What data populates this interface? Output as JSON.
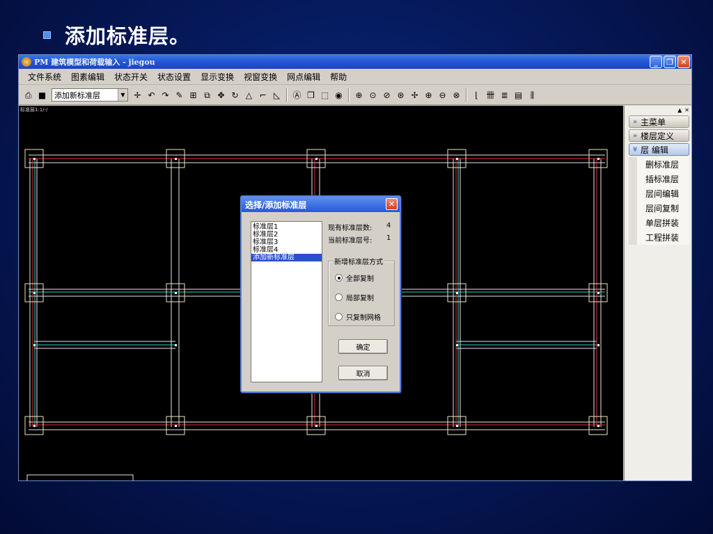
{
  "slide": {
    "title": "添加标准层。",
    "bullet_color": "#4f8de8"
  },
  "window": {
    "title": "PM 建筑模型和荷载输入 - jiegou",
    "buttons": {
      "minimize": "_",
      "maximize": "❐",
      "close": "✕"
    }
  },
  "menu": [
    "文件系统",
    "图素编辑",
    "状态开关",
    "状态设置",
    "显示变换",
    "视窗变换",
    "网点编辑",
    "帮助"
  ],
  "toolbar": {
    "combo_value": "添加新标准层",
    "combo_arrow": "▼"
  },
  "canvas": {
    "tag": "标准层1:1/-/",
    "background": "#000000"
  },
  "side_panel": {
    "controls": [
      "▲",
      "✕"
    ],
    "headers": [
      {
        "label": "主菜单",
        "chevron": "»"
      },
      {
        "label": "楼层定义",
        "chevron": "»"
      },
      {
        "label": "层  编辑",
        "chevron": "¥"
      }
    ],
    "items": [
      "删标准层",
      "插标准层",
      "层间编辑",
      "层间复制",
      "单层拼装",
      "工程拼装"
    ]
  },
  "dialog": {
    "title": "选择/添加标准层",
    "close": "✕",
    "list": [
      "标准层1",
      "标准层2",
      "标准层3",
      "标准层4",
      "添加新标准层"
    ],
    "info_count_label": "现有标准层数:",
    "info_count_value": "4",
    "info_current_label": "当前标准层号:",
    "info_current_value": "1",
    "group_label": "新增标准层方式",
    "options": [
      "全部复制",
      "局部复制",
      "只复制网格"
    ],
    "ok": "确定",
    "cancel": "取消"
  }
}
